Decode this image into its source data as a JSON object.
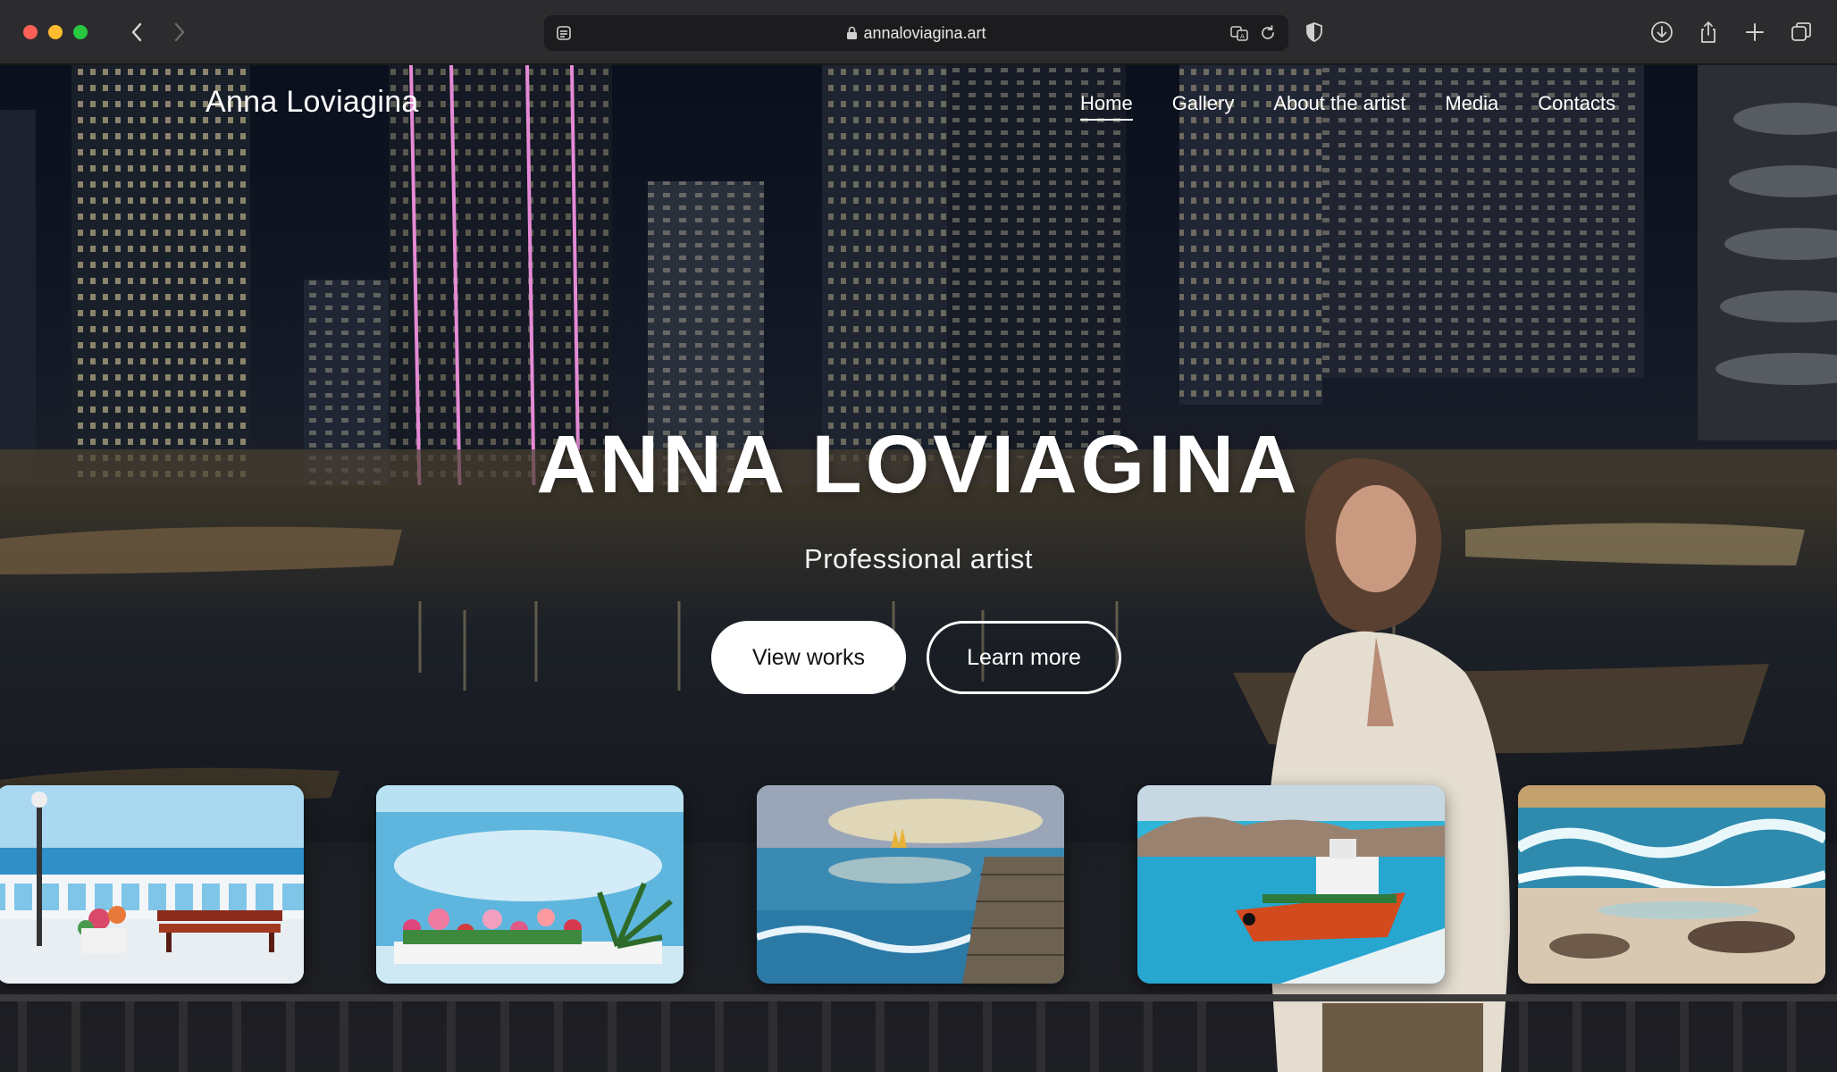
{
  "browser": {
    "url": "annaloviagina.art"
  },
  "site": {
    "logo": "Anna Loviagina",
    "nav": [
      {
        "label": "Home",
        "active": true
      },
      {
        "label": "Gallery",
        "active": false
      },
      {
        "label": "About the artist",
        "active": false
      },
      {
        "label": "Media",
        "active": false
      },
      {
        "label": "Contacts",
        "active": false
      }
    ]
  },
  "hero": {
    "title": "ANNA LOVIAGINA",
    "subtitle": "Professional artist",
    "primary_button": "View works",
    "secondary_button": "Learn more"
  },
  "colors": {
    "primary_button_bg": "#ffffff",
    "primary_button_text": "#111111",
    "text": "#ffffff"
  }
}
